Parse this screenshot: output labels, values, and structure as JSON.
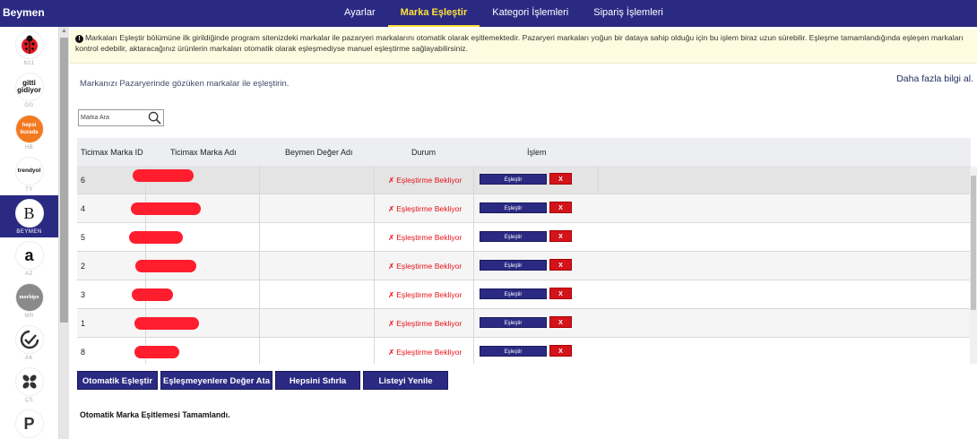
{
  "app": {
    "brand": "Beymen"
  },
  "nav": {
    "items": [
      {
        "label": "Ayarlar",
        "active": false
      },
      {
        "label": "Marka Eşleştir",
        "active": true
      },
      {
        "label": "Kategori İşlemleri",
        "active": false
      },
      {
        "label": "Sipariş İşlemleri",
        "active": false
      }
    ]
  },
  "sidebar": {
    "items": [
      {
        "code": "N11",
        "logo_text": "",
        "icon": "ladybug-icon"
      },
      {
        "code": "GG",
        "logo_text": "gitti gidiyor",
        "icon": "gittigidiyor-logo"
      },
      {
        "code": "HB",
        "logo_text": "hepsi burada",
        "icon": "hepsiburada-logo"
      },
      {
        "code": "TY",
        "logo_text": "trendyol",
        "icon": "trendyol-logo"
      },
      {
        "code": "BEYMEN",
        "logo_text": "B",
        "icon": "beymen-logo",
        "active": true
      },
      {
        "code": "AZ",
        "logo_text": "a",
        "icon": "amazon-logo"
      },
      {
        "code": "MR",
        "logo_text": "morhipo",
        "icon": "morhipo-logo"
      },
      {
        "code": "AK",
        "logo_text": "",
        "icon": "akakce-logo"
      },
      {
        "code": "ÇS",
        "logo_text": "",
        "icon": "ciceksepeti-logo"
      },
      {
        "code": "",
        "logo_text": "P",
        "icon": "pazarama-logo"
      }
    ]
  },
  "notice": {
    "text": "Markaları Eşleştir bölümüne ilk girildiğinde program sitenizdeki markalar ile pazaryeri markalarını otomatik olarak eşitlemektedir. Pazaryeri markaları yoğun bir dataya sahip olduğu için bu işlem biraz uzun sürebilir. Eşleşme tamamlandığında eşleşen markaları kontrol edebilir, aktaracağınız ürünlerin markaları otomatik olarak eşleşmediyse manuel eşleştirme sağlayabilirsiniz."
  },
  "main": {
    "subtitle": "Markanızı Pazaryerinde gözüken markalar ile eşleştirin.",
    "more_link": "Daha fazla bilgi al.",
    "search": {
      "placeholder": "Marka Ara",
      "value": ""
    }
  },
  "table": {
    "headers": {
      "id": "Ticimax Marka ID",
      "name": "Ticimax Marka Adı",
      "beymen": "Beymen Değer Adı",
      "status": "Durum",
      "action": "İşlem"
    },
    "rows": [
      {
        "id": "6",
        "status": "Eşleştirme Bekliyor"
      },
      {
        "id": "4",
        "status": "Eşleştirme Bekliyor"
      },
      {
        "id": "5",
        "status": "Eşleştirme Bekliyor"
      },
      {
        "id": "2",
        "status": "Eşleştirme Bekliyor"
      },
      {
        "id": "3",
        "status": "Eşleştirme Bekliyor"
      },
      {
        "id": "1",
        "status": "Eşleştirme Bekliyor"
      },
      {
        "id": "8",
        "status": "Eşleştirme Bekliyor"
      }
    ],
    "match_label": "Eşleştir",
    "remove_label": "X",
    "status_icon": "✗"
  },
  "actions": [
    {
      "label": "Otomatik Eşleştir"
    },
    {
      "label": "Eşleşmeyenlere Değer Ata"
    },
    {
      "label": "Hepsini Sıfırla"
    },
    {
      "label": "Listeyi Yenile"
    }
  ],
  "status_message": "Otomatik Marka Eşitlemesi Tamamlandı.",
  "colors": {
    "primary": "#2b2a83",
    "active_nav": "#ffe23a",
    "danger": "#d3141b",
    "notice_bg": "#fdfce0"
  }
}
